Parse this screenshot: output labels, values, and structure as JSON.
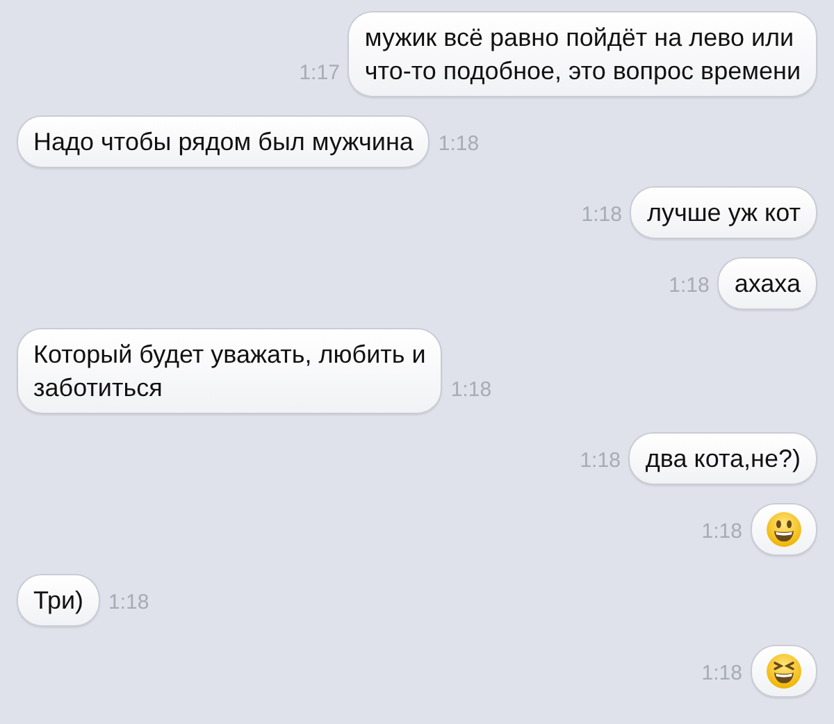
{
  "messages": [
    {
      "kind": "outgoing",
      "text": "мужик всё равно пойдёт на лево или\nчто-то подобное, это вопрос времени",
      "time": "1:17"
    },
    {
      "kind": "incoming",
      "text": "Надо чтобы рядом был мужчина",
      "time": "1:18"
    },
    {
      "kind": "outgoing",
      "text": "лучше уж кот",
      "time": "1:18"
    },
    {
      "kind": "outgoing",
      "text": "ахаха",
      "time": "1:18"
    },
    {
      "kind": "incoming",
      "text": "Который будет уважать, любить и\nзаботиться",
      "time": "1:18"
    },
    {
      "kind": "outgoing",
      "text": "два кота,не?)",
      "time": "1:18"
    },
    {
      "kind": "smiley",
      "time": "1:18"
    },
    {
      "kind": "incoming",
      "text": "Три)",
      "time": "1:18"
    },
    {
      "kind": "laughing",
      "time": "1:18"
    }
  ]
}
